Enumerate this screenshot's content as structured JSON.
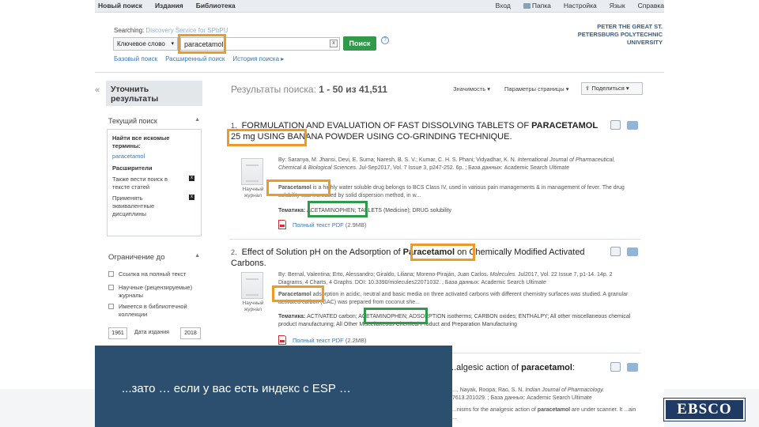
{
  "topbar": {
    "left": [
      "Новый поиск",
      "Издания",
      "Библиотека"
    ],
    "right": [
      "Вход",
      "Папка",
      "Настройка",
      "Язык",
      "Справка"
    ]
  },
  "search": {
    "searching_label": "Searching:",
    "service": "Discovery Service for SPbPU",
    "field_select": "Ключевое слово",
    "query": "paracetamol",
    "clear": "x",
    "button": "Поиск",
    "help": "?",
    "links": [
      "Базовый поиск",
      "Расширенный поиск",
      "История поиска ▸"
    ]
  },
  "university": [
    "PETER THE GREAT ST.",
    "PETERSBURG POLYTECHNIC",
    "UNIVERSITY"
  ],
  "sidebar": {
    "collapse": "«",
    "refine_title": "Уточнить результаты",
    "current_search": "Текущий поиск",
    "find_all_terms": "Найти все искомые термины:",
    "term": "paracetamol",
    "expanders": "Расширители",
    "expander_items": [
      "Также вести поиск в тексте статей",
      "Применять эквивалентные дисциплины"
    ],
    "expander_remove": "x",
    "limit_title": "Ограничение до",
    "limit_items": [
      "Ссылка на полный текст",
      "Научные (рецензируемые) журналы",
      "Имеется в библиотечной коллекции"
    ],
    "year_from": "1961",
    "year_label": "Дата издания",
    "year_to": "2018"
  },
  "results_header": {
    "label": "Результаты поиска:",
    "range": "1 - 50 из 41,511",
    "relevance": "Значимость ▾",
    "page_options": "Параметры страницы ▾",
    "share": "Поделиться ▾"
  },
  "results": [
    {
      "num": "1.",
      "title_a": "FORMULATION AND EVALUATION OF FAST DISSOLVING TABLETS OF",
      "title_hl": "PARACETAMOL",
      "title_b": "25 mg USING BANANA POWDER USING CO-GRINDING TECHNIQUE.",
      "meta_a": "By: Saranya, M. Jhansi, Devi, E. Suma; Naresh, B. S. V.; Kumar, C. H. S. Phani; Vidyadhar, K. N.",
      "meta_journal": "International Journal of Pharmaceutical, Chemical & Biological Sciences.",
      "meta_b": "Jul-Sep2017, Vol. 7 Issue 3, p247-252. 6p. ; База данных: Academic Search Ultimate",
      "abs_hl": "Paracetamol",
      "abs": "is a highly water soluble drug belongs to BCS Class IV, used in various pain managements & in management of fever. The drug solubility was increased by solid dispersion method, in w...",
      "subj_label": "Тематика:",
      "subj_hl": "ACETAMINOPHEN",
      "subj": "; TABLETS (Medicine); DRUG solubility",
      "type": "Научный журнал",
      "pdf": "Полный текст PDF",
      "pdf_size": "(2.9MB)"
    },
    {
      "num": "2.",
      "title_a": "Effect of Solution pH on the Adsorption of",
      "title_hl": "Paracetamol",
      "title_b": "on Chemically Modified Activated Carbons.",
      "meta_a": "By: Bernal, Valentina; Erto, Alessandro; Giraldo, Liliana; Moreno-Piraján, Juan Carlos.",
      "meta_journal": "Molecules.",
      "meta_b": "Jul2017, Vol. 22 Issue 7, p1-14. 14p. 2 Diagrams, 4 Charts, 4 Graphs. DOI: 10.3390/molecules22071032. , База данных: Academic Search Ultimate",
      "abs_hl": "Paracetamol",
      "abs": "adsorption in acidic, neutral and basic media on three activated carbons with different chemistry surfaces was studied. A granular activated carbon (GAC) was prepared from coconut she...",
      "subj_label": "Тематика:",
      "subj_a": "ACTIVATED carbon;",
      "subj_hl": "ACETAMINOPHEN",
      "subj": "; ADSORPTION isotherms; CARBON oxides; ENTHALPY; All other miscellaneous chemical product manufacturing; All Other Miscellaneous Chemical Product and Preparation Manufacturing",
      "type": "Научный журнал",
      "pdf": "Полный текст PDF",
      "pdf_size": "(2.2MB)"
    },
    {
      "title_a": "...algesic action of",
      "title_hl": "paracetamol",
      "title_b": ":",
      "meta_a": "..., Nayak, Roopa; Rao, S. N.",
      "meta_journal": "Indian Journal of Pharmacology.",
      "meta_b": "7613.201029. ; База данных: Academic Search Ultimate",
      "abs_a": "...nisms for the analgesic action of",
      "abs_hl": "paracetamol",
      "abs": "are under scanner. It ...ain ..."
    }
  ],
  "overlay_text": "...зато … если у вас есть индекс с ESP …",
  "logo": "EBSCO",
  "colors": {
    "highlight_orange": "#ee9a28",
    "highlight_green": "#2f9a48",
    "overlay_bg": "#2d4f6f",
    "link": "#3a77b5"
  }
}
